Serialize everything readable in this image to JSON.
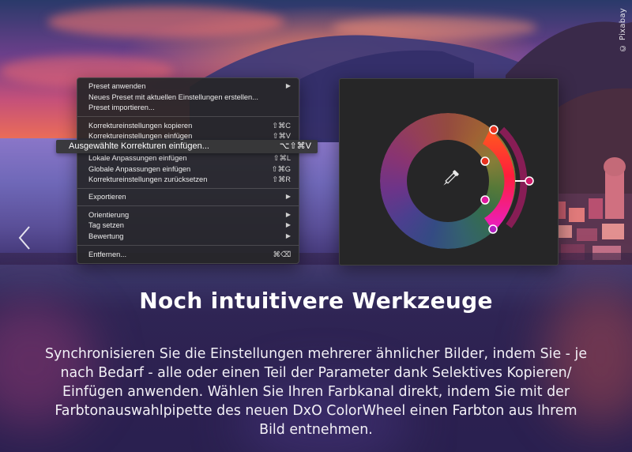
{
  "credit": "© Pixabay",
  "context_menu": {
    "items": [
      {
        "label": "Preset anwenden",
        "shortcut": "",
        "submenu": true
      },
      {
        "label": "Neues Preset mit aktuellen Einstellungen erstellen...",
        "shortcut": "",
        "submenu": false
      },
      {
        "label": "Preset importieren...",
        "shortcut": "",
        "submenu": false
      },
      {
        "label": "Korrektureinstellungen kopieren",
        "shortcut": "⇧⌘C",
        "submenu": false
      },
      {
        "label": "Korrektureinstellungen einfügen",
        "shortcut": "⇧⌘V",
        "submenu": false
      },
      {
        "label": "Lokale Anpassungen einfügen",
        "shortcut": "⇧⌘L",
        "submenu": false
      },
      {
        "label": "Globale Anpassungen einfügen",
        "shortcut": "⇧⌘G",
        "submenu": false
      },
      {
        "label": "Korrektureinstellungen zurücksetzen",
        "shortcut": "⇧⌘R",
        "submenu": false
      },
      {
        "label": "Exportieren",
        "shortcut": "",
        "submenu": true
      },
      {
        "label": "Orientierung",
        "shortcut": "",
        "submenu": true
      },
      {
        "label": "Tag setzen",
        "shortcut": "",
        "submenu": true
      },
      {
        "label": "Bewertung",
        "shortcut": "",
        "submenu": true
      },
      {
        "label": "Entfernen...",
        "shortcut": "⌘⌫",
        "submenu": false
      }
    ],
    "highlighted": {
      "label": "Ausgewählte Korrekturen einfügen...",
      "shortcut": "⌥⇧⌘V"
    },
    "submenu_glyph": "▶"
  },
  "colors": {
    "accent_red": "#e8321e",
    "accent_magenta": "#e01aa0"
  },
  "headline": "Noch intuitivere Werkzeuge",
  "body_lines": [
    "Synchronisieren Sie die Einstellungen mehrerer ähnlicher Bilder, indem Sie - je",
    "nach Bedarf - alle oder einen Teil der Parameter dank Selektives Kopieren/",
    "Einfügen anwenden. Wählen Sie Ihren Farbkanal direkt, indem Sie mit der",
    "Farbtonauswahlpipette des neuen DxO ColorWheel einen Farbton aus Ihrem",
    "Bild entnehmen."
  ]
}
